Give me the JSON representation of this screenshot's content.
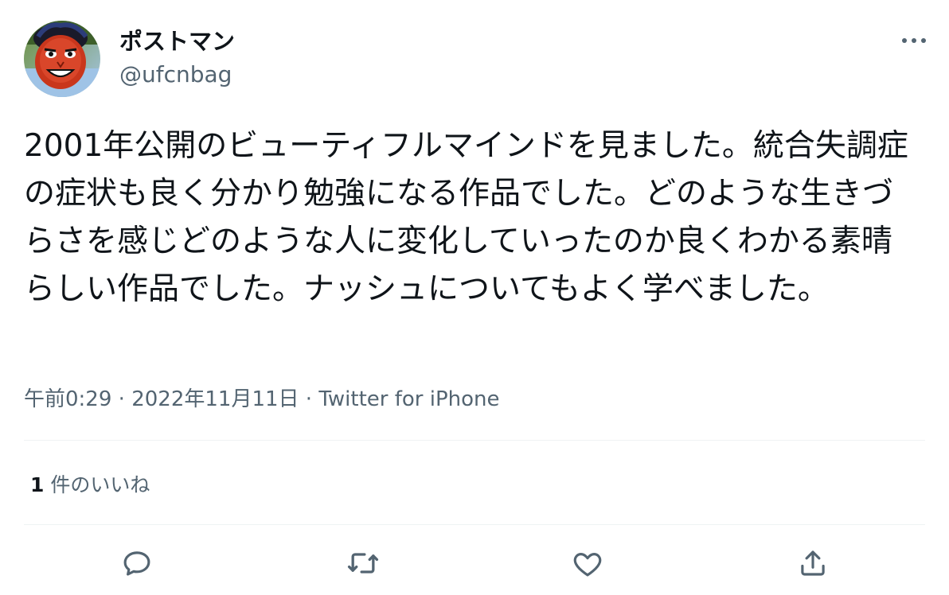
{
  "user": {
    "display_name": "ポストマン",
    "handle": "@ufcnbag"
  },
  "tweet": {
    "text": "2001年公開のビューティフルマインドを見ました。統合失調症の症状も良く分かり勉強になる作品でした。どのような生きづらさを感じどのような人に変化していったのか良くわかる素晴らしい作品でした。ナッシュについてもよく学べました。",
    "time": "午前0:29",
    "separator": " · ",
    "date": "2022年11月11日",
    "source": "Twitter for iPhone"
  },
  "likes": {
    "count": "1",
    "label": "件のいいね"
  },
  "icons": {
    "more": "more-horizontal-icon",
    "reply": "reply-icon",
    "retweet": "retweet-icon",
    "like": "heart-icon",
    "share": "share-icon"
  },
  "colors": {
    "text_primary": "#0f1419",
    "text_secondary": "#536471",
    "divider": "#eff3f4"
  }
}
